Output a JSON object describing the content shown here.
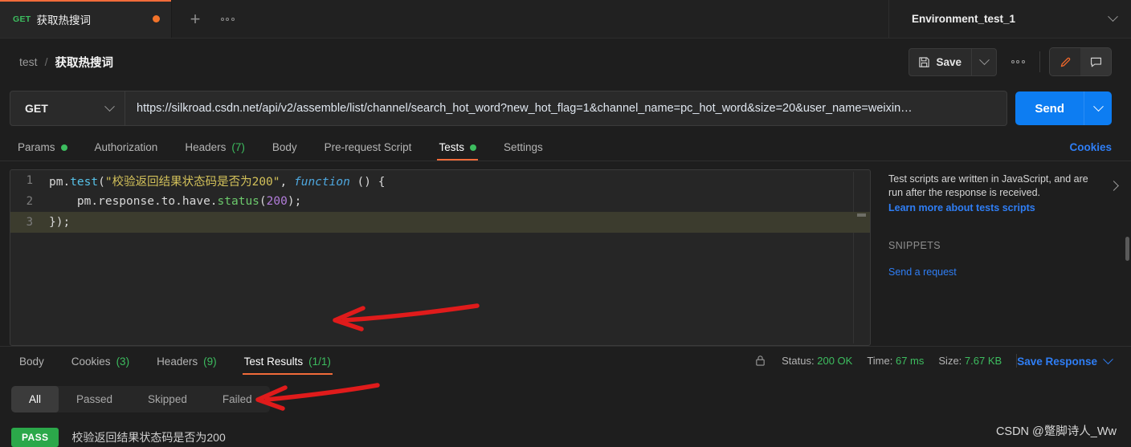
{
  "tabbar": {
    "request_tab": {
      "method": "GET",
      "name": "获取热搜词",
      "unsaved": "●"
    },
    "new_tab_icon": "+",
    "more_icon": "...",
    "environment": {
      "name": "Environment_test_1"
    }
  },
  "breadcrumb": {
    "root": "test",
    "separator": "/",
    "leaf": "获取热搜词"
  },
  "toolbar": {
    "save_label": "Save",
    "save_caret": "⌄",
    "more_label": "...",
    "edit_icon": "pencil-icon",
    "comment_icon": "comment-icon"
  },
  "url_row": {
    "method": "GET",
    "url": "https://silkroad.csdn.net/api/v2/assemble/list/channel/search_hot_word?new_hot_flag=1&channel_name=pc_hot_word&size=20&user_name=weixin…",
    "send_label": "Send"
  },
  "request_tabs": {
    "items": [
      {
        "label": "Params",
        "dot": true,
        "count": "",
        "active": false
      },
      {
        "label": "Authorization",
        "dot": false,
        "count": "",
        "active": false
      },
      {
        "label": "Headers",
        "dot": false,
        "count": "(7)",
        "active": false
      },
      {
        "label": "Body",
        "dot": false,
        "count": "",
        "active": false
      },
      {
        "label": "Pre-request Script",
        "dot": false,
        "count": "",
        "active": false
      },
      {
        "label": "Tests",
        "dot": true,
        "count": "",
        "active": true
      },
      {
        "label": "Settings",
        "dot": false,
        "count": "",
        "active": false
      }
    ],
    "cookies_link": "Cookies"
  },
  "editor": {
    "lines": [
      {
        "number": "1",
        "highlight": false,
        "tokens": [
          {
            "t": "pm",
            "c": "t-plain"
          },
          {
            "t": ".",
            "c": "t-plain"
          },
          {
            "t": "test",
            "c": "t-prop"
          },
          {
            "t": "(",
            "c": "t-plain"
          },
          {
            "t": "\"校验返回结果状态码是否为200\"",
            "c": "t-str"
          },
          {
            "t": ", ",
            "c": "t-plain"
          },
          {
            "t": "function",
            "c": "t-kw"
          },
          {
            "t": " () {",
            "c": "t-plain"
          }
        ]
      },
      {
        "number": "2",
        "highlight": false,
        "tokens": [
          {
            "t": "    pm",
            "c": "t-plain"
          },
          {
            "t": ".response.to.have.",
            "c": "t-plain"
          },
          {
            "t": "status",
            "c": "t-fn"
          },
          {
            "t": "(",
            "c": "t-plain"
          },
          {
            "t": "200",
            "c": "t-num"
          },
          {
            "t": ");",
            "c": "t-plain"
          }
        ]
      },
      {
        "number": "3",
        "highlight": true,
        "tokens": [
          {
            "t": "});",
            "c": "t-plain"
          }
        ]
      }
    ]
  },
  "help": {
    "description": "Test scripts are written in JavaScript, and are run after the response is received.",
    "learn_more": "Learn more about tests scripts",
    "snippets_title": "SNIPPETS",
    "snippets": [
      "Send a request"
    ],
    "collapse_icon": "chevron-right-icon"
  },
  "response": {
    "tabs": [
      {
        "label": "Body",
        "count": "",
        "active": false
      },
      {
        "label": "Cookies",
        "count": "(3)",
        "active": false
      },
      {
        "label": "Headers",
        "count": "(9)",
        "active": false
      },
      {
        "label": "Test Results",
        "count": "(1/1)",
        "active": true
      }
    ],
    "status_label": "Status:",
    "status_value": "200 OK",
    "time_label": "Time:",
    "time_value": "67 ms",
    "size_label": "Size:",
    "size_value": "7.67 KB",
    "save_response": "Save Response",
    "lock_icon": "lock-icon",
    "filters": [
      {
        "label": "All",
        "active": true
      },
      {
        "label": "Passed",
        "active": false
      },
      {
        "label": "Skipped",
        "active": false
      },
      {
        "label": "Failed",
        "active": false
      }
    ],
    "results": [
      {
        "status": "PASS",
        "name": "校验返回结果状态码是否为200"
      }
    ]
  },
  "watermark": "CSDN @蹩脚诗人_Ww",
  "annotations": {
    "arrow_color": "#e01b1b",
    "arrows": [
      "arrow-to-test-results-tab",
      "arrow-to-pass-result"
    ]
  }
}
